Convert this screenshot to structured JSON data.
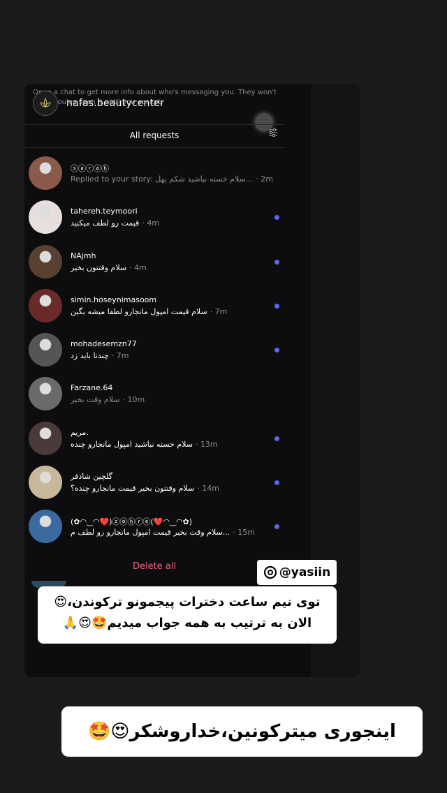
{
  "header": {
    "profile_name": "nafas.beautycenter",
    "hint_text": "Open a chat to get more info about who's messaging you. They won't know you've seen it until you accept.",
    "tab_label": "All requests",
    "filter_icon": "sliders-icon"
  },
  "requests": [
    {
      "name": "ⓢⓐⓡⓐⓗ",
      "message": "Replied to your story: سلام خسته نباشید شکم پهل...",
      "time": "2m",
      "unread": false,
      "avatar_color": "#8a5a4a"
    },
    {
      "name": "tahereh.teymoori",
      "message": "قیمت رو لطف میکنید",
      "time": "4m",
      "unread": true,
      "avatar_color": "#e8dede"
    },
    {
      "name": "NAjmh",
      "message": "سلام وقتتون بخیر",
      "time": "4m",
      "unread": true,
      "avatar_color": "#5a4030"
    },
    {
      "name": "simin.hoseynimasoom",
      "message": "سلام قیمت امپول مانجارو لطفا میشه بگین",
      "time": "7m",
      "unread": true,
      "avatar_color": "#6a2a2a"
    },
    {
      "name": "mohadesemzn77",
      "message": "چندتا باید زد",
      "time": "7m",
      "unread": true,
      "avatar_color": "#555555"
    },
    {
      "name": "Farzane.64",
      "message": "سلام وقت بخیر",
      "time": "10m",
      "unread": false,
      "avatar_color": "#6a6a6a"
    },
    {
      "name": "مریم.",
      "message": "سلام خسته نباشید امپول مانجارو چنده",
      "time": "13m",
      "unread": true,
      "avatar_color": "#4a3a3a"
    },
    {
      "name": "گلچین شادفر",
      "message": "سلام وقتتون بخیر قیمت مانجارو چنده؟",
      "time": "14m",
      "unread": true,
      "avatar_color": "#c8b89a"
    },
    {
      "name": "(✿◠‿◠❤️)ⓩⓞⓗⓡⓔ(❤️◠‿◠✿)",
      "message": "سلام وقت بخیر قیمت امپول مانجارو رو لطف م...",
      "time": "15m",
      "unread": true,
      "avatar_color": "#3a6aa0"
    }
  ],
  "footer": {
    "delete_all": "Delete all"
  },
  "overlay": {
    "credit": "@yasiin",
    "caption1_line1": "توی نیم ساعت دخترات پیجمونو ترکوندن،😍",
    "caption1_line2": "الان به ترتیب به همه جواب میدیم🤩😍🙏",
    "caption2": "اینجوری میترکونین،خداروشکر😍🤩"
  }
}
